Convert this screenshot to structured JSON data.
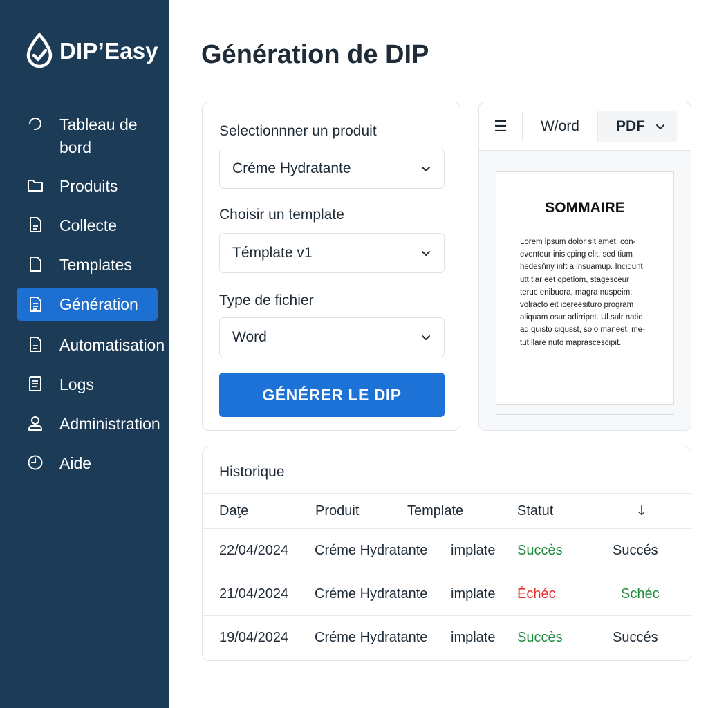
{
  "app": {
    "name": "DIP’Easy"
  },
  "sidebar": {
    "items": [
      {
        "label": "Tableau de",
        "label2": "bord",
        "icon": "dashboard-icon"
      },
      {
        "label": "Produits",
        "icon": "folder-icon"
      },
      {
        "label": "Collecte",
        "icon": "document-icon"
      },
      {
        "label": "Templates",
        "icon": "file-icon"
      },
      {
        "label": "Génération",
        "icon": "document-icon",
        "active": true
      },
      {
        "label": "Automatisation",
        "icon": "document-icon"
      },
      {
        "label": "Logs",
        "icon": "log-icon"
      },
      {
        "label": "Administration",
        "icon": "user-icon"
      },
      {
        "label": "Aide",
        "icon": "clock-icon"
      }
    ]
  },
  "main": {
    "title": "Génération de DIP"
  },
  "form": {
    "product_label": "Selectionnner un produit",
    "product_value": "Créme Hydratante",
    "template_label": "Choisir un template",
    "template_value": "Témplate v1",
    "filetype_label": "Type de fichier",
    "filetype_value": "Word",
    "generate_label": "GÉNÉRER LE DIP"
  },
  "preview": {
    "toolbar": {
      "menu": "☰",
      "word": "W/ord",
      "pdf": "PDF"
    },
    "doc_title": "SOMMAIRE",
    "doc_lines": [
      "Lorem ipsum dolor sit amet, con-",
      "eventeur inisicping elit, sed tium",
      "hedesňriy inft a insuamup. Incidunt",
      "utt tlar eet opetiom, stagesceur",
      "teruc enibuora, magra nuspeim:",
      "volracto eit icereesituro program",
      "aliquam osur adirripet. Ul sulr natio",
      "ad quisto ciqusst, solo maneet, me-",
      "tut llare nuto maprascescipit."
    ]
  },
  "history": {
    "title": "Historique",
    "columns": [
      "Daţe",
      "Produit",
      "Template",
      "Statut",
      "⤓"
    ],
    "rows": [
      {
        "date": "22/04/2024",
        "product": "Créme Hydratante",
        "template": "implate",
        "status": "Succès",
        "status_type": "ok",
        "extra": "Succés",
        "extra_type": "plain"
      },
      {
        "date": "21/04/2024",
        "product": "Créme Hydratante",
        "template": "implate",
        "status": "Échéc",
        "status_type": "fail",
        "extra": "Schéc",
        "extra_type": "ok"
      },
      {
        "date": "19/04/2024",
        "product": "Créme Hydratante",
        "template": "implate",
        "status": "Succès",
        "status_type": "ok",
        "extra": "Succés",
        "extra_type": "plain"
      }
    ]
  },
  "colors": {
    "sidebar_bg": "#1c3b57",
    "accent": "#1d72d8",
    "success": "#1e8a3c",
    "error": "#e0312b"
  }
}
